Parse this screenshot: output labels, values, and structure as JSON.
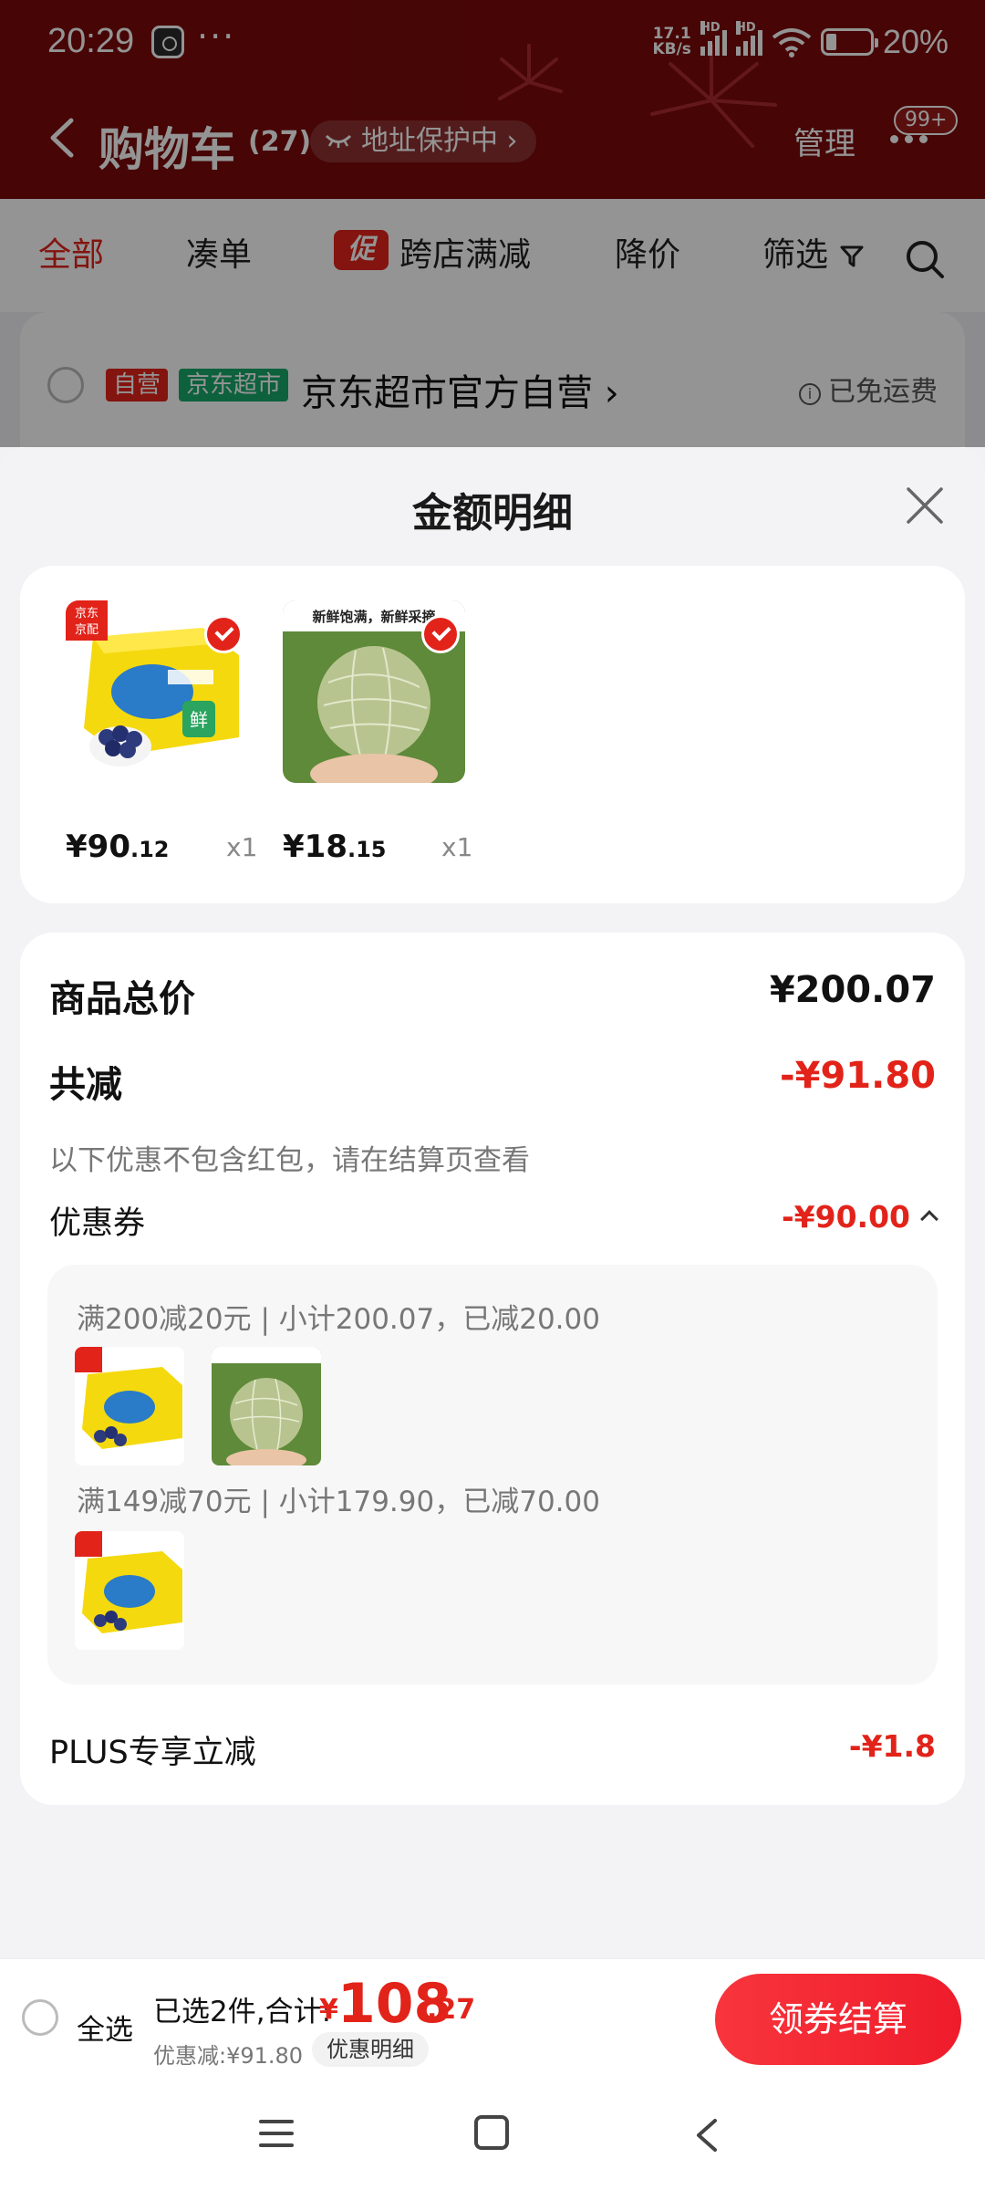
{
  "status_bar": {
    "time": "20:29",
    "more": "···",
    "net_speed_value": "17.1",
    "net_speed_unit": "KB/s",
    "sim1": "HD",
    "sim2": "HD",
    "battery": "20%"
  },
  "header": {
    "title": "购物车",
    "count": "(27)",
    "address_protect": "地址保护中 ›",
    "manage": "管理",
    "badge": "99+"
  },
  "filters": {
    "all": "全部",
    "bundle": "凑单",
    "promo_tag": "促",
    "cross_store": "跨店满减",
    "price_drop": "降价",
    "filter": "筛选"
  },
  "store": {
    "tag_self": "自营",
    "tag_market": "京东超市",
    "name": "京东超市官方自营 ›",
    "shipping": "已免运费"
  },
  "sheet": {
    "title": "金额明细",
    "products": [
      {
        "price_int": "¥90",
        "price_dec": ".12",
        "qty": "x1"
      },
      {
        "price_int": "¥18",
        "price_dec": ".15",
        "qty": "x1"
      }
    ],
    "total_label": "商品总价",
    "total_value": "¥200.07",
    "reduce_label": "共减",
    "reduce_value": "-¥91.80",
    "note": "以下优惠不包含红包，请在结算页查看",
    "coupon_label": "优惠券",
    "coupon_value": "-¥90.00",
    "coupon_rules": [
      "满200减20元 | 小计200.07，已减20.00",
      "满149减70元 | 小计179.90，已减70.00"
    ],
    "plus_label": "PLUS专享立减",
    "plus_value": "-¥1.8",
    "melon_banner": "新鲜饱满，新鲜采摘",
    "blueberry_brand": "京东京配",
    "blueberry_char": "鲜"
  },
  "bottom_bar": {
    "select_all": "全选",
    "selected_text": "已选2件,合计:",
    "currency": "¥",
    "total_int": "108",
    "total_dec": ".27",
    "discount_text": "优惠减:¥91.80",
    "discount_detail": "优惠明细",
    "checkout": "领券结算"
  },
  "colors": {
    "brand_red": "#e2231a",
    "header_bg": "#7a0a0a",
    "market_green": "#17a86a"
  }
}
